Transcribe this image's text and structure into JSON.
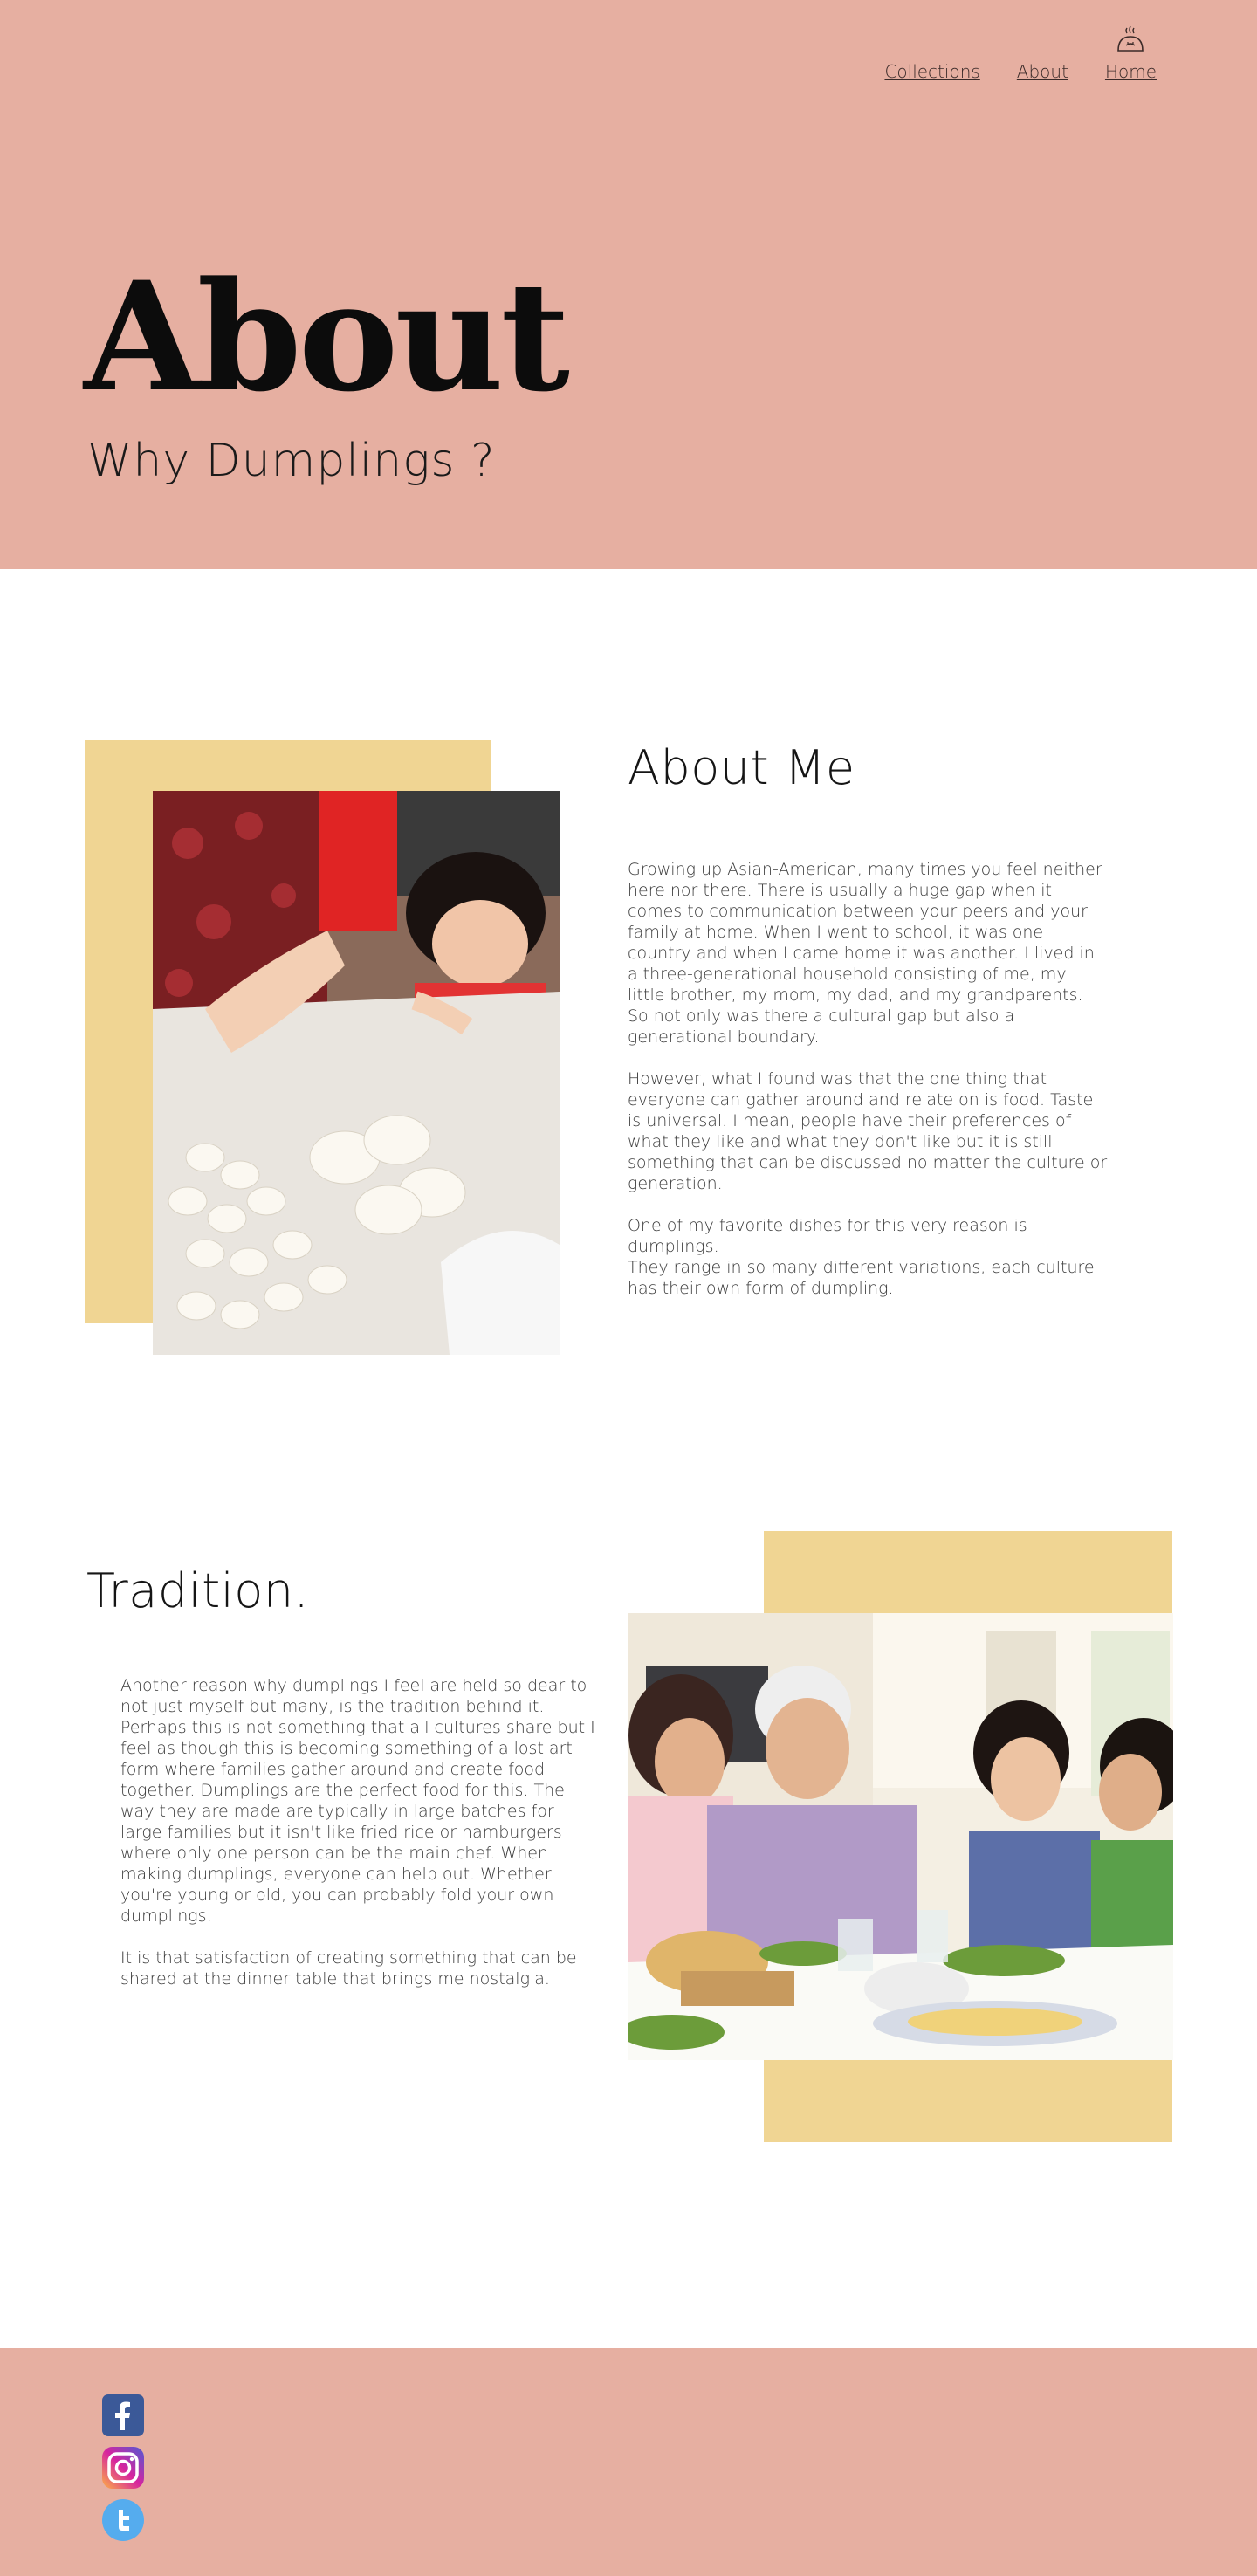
{
  "nav": {
    "logo_icon": "dumpling-icon",
    "links": [
      {
        "label": "Collections"
      },
      {
        "label": "About"
      },
      {
        "label": "Home"
      }
    ]
  },
  "hero": {
    "title": "About",
    "subtitle": "Why Dumplings ?"
  },
  "about_me": {
    "heading": "About Me",
    "paragraphs": [
      "Growing up Asian-American,  many times you feel neither here nor there. There is usually a huge gap when it comes to communication between your peers and your family at home. When I went to school, it was one country and when I came home it was another. I lived in a three-generational household consisting of me, my little brother, my mom, my dad, and my grandparents. So not only was there a cultural gap but also a generational boundary.",
      "However, what I found was that the one thing that everyone can gather around and relate on is food. Taste is universal. I mean, people have their preferences of what they like and what they don't like but it is still something that can be discussed no matter the culture or generation.",
      "One of my favorite dishes for this very reason is dumplings.",
      "They range in so many different variations, each culture has their own form of dumpling."
    ]
  },
  "tradition": {
    "heading": "Tradition.",
    "paragraphs": [
      "Another reason why dumplings I feel are held so dear to not just myself but many, is the tradition behind it. Perhaps this is not something that all cultures share but I feel as though this is becoming something of a lost art form where families gather around and create food together. Dumplings are the perfect food for this. The way they are made are typically in large batches for large families but it isn't like fried rice or hamburgers where only one person can be the main chef. When making dumplings, everyone can help out. Whether you're young or old, you can probably fold your own dumplings.",
      "It is that satisfaction of creating something that can be shared at the dinner table that brings me nostalgia."
    ]
  },
  "footer": {
    "social": [
      {
        "icon": "facebook-icon",
        "color": "#3b5998"
      },
      {
        "icon": "instagram-icon",
        "color": "#d6249f"
      },
      {
        "icon": "twitter-icon",
        "color": "#55acee"
      }
    ]
  },
  "colors": {
    "header_bg": "#e6afa1",
    "accent_yellow": "#f0d593",
    "footer_bg": "#e6afa1"
  }
}
